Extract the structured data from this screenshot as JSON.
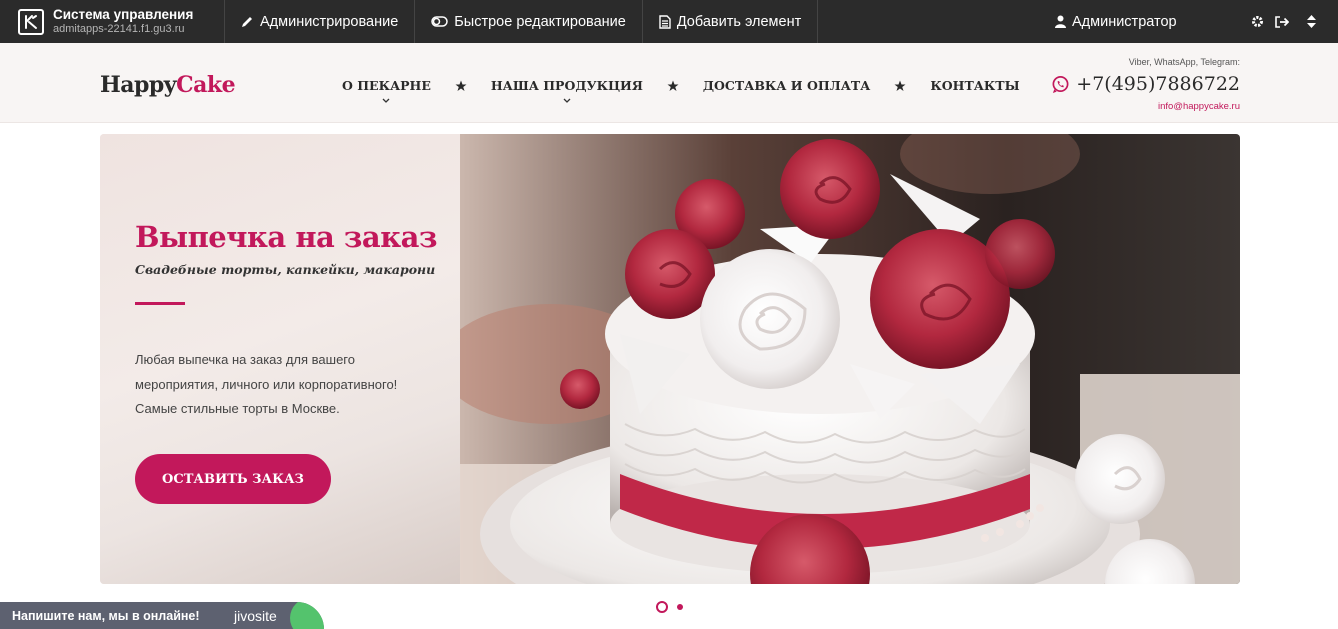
{
  "admin_bar": {
    "title": "Система управления",
    "subtitle": "admitapps-22141.f1.gu3.ru",
    "items": [
      {
        "label": "Администрирование",
        "icon": "pencil-icon"
      },
      {
        "label": "Быстрое редактирование",
        "icon": "toggle-icon"
      },
      {
        "label": "Добавить элемент",
        "icon": "document-icon"
      }
    ],
    "user": "Администратор",
    "tools": [
      "gear-icon",
      "logout-icon",
      "sort-arrows-icon"
    ]
  },
  "header": {
    "logo_part1": "Happy",
    "logo_part2": "Cake",
    "nav": [
      {
        "label": "О ПЕКАРНЕ",
        "has_dropdown": true
      },
      {
        "label": "НАША ПРОДУКЦИЯ",
        "has_dropdown": true
      },
      {
        "label": "ДОСТАВКА И ОПЛАТА",
        "has_dropdown": false
      },
      {
        "label": "КОНТАКТЫ",
        "has_dropdown": false
      }
    ],
    "contact_note": "Viber, WhatsApp, Telegram:",
    "phone": "+7(495)7886722",
    "email": "info@happycake.ru"
  },
  "hero": {
    "title": "Выпечка на заказ",
    "subtitle": "Свадебные торты, капкейки, макарони",
    "text_lines": [
      "Любая выпечка на заказ для вашего",
      "мероприятия, личного или корпоративного!",
      "Самые стильные торты в Москве."
    ],
    "button": "ОСТАВИТЬ ЗАКАЗ",
    "slides_total": 2,
    "active_slide": 1
  },
  "chat": {
    "label": "Напишите нам, мы в онлайне!",
    "brand": "jivosite"
  },
  "colors": {
    "accent": "#c2185b",
    "admin_bg": "#2b2b2b",
    "header_bg": "#f8f5f4",
    "chat_bg": "#5d6170",
    "chat_green": "#54c36d"
  }
}
